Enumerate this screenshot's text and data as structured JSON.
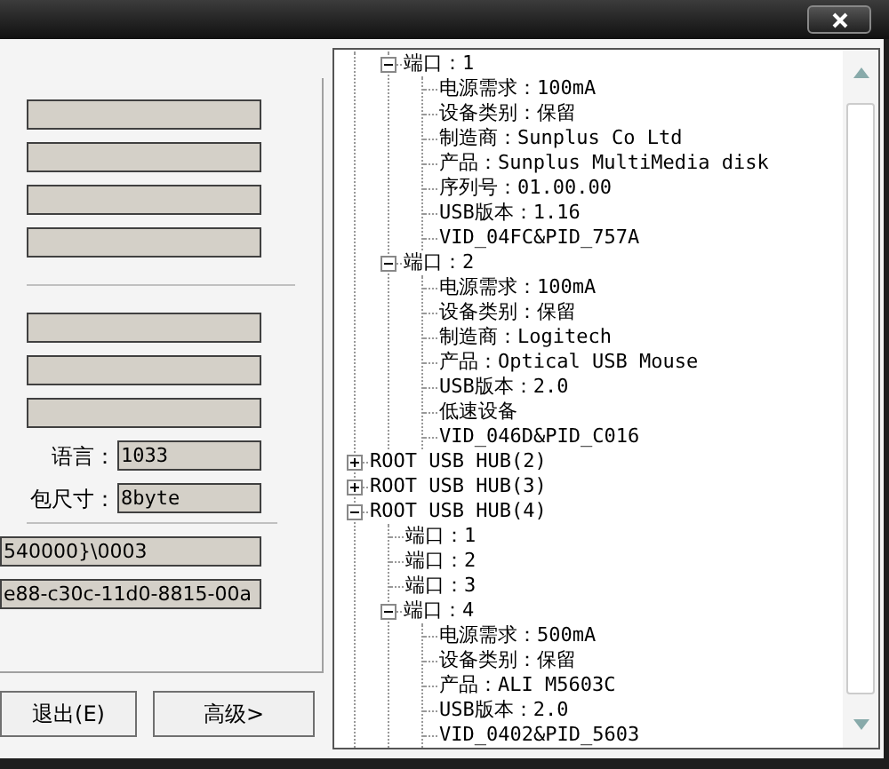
{
  "settings": [
    {
      "label": "语言：",
      "value": "1033"
    },
    {
      "label": "包尺寸：",
      "value": "8byte"
    }
  ],
  "ids": [
    "540000}\\0003",
    "e88-c30c-11d0-8815-00a"
  ],
  "buttons": [
    "退出(E)",
    "高级>"
  ],
  "tree": [
    {
      "children": [
        {
          "label": "端口：1",
          "expanded": true,
          "children": [
            {
              "label": "电源需求：100mA"
            },
            {
              "label": "设备类别：保留"
            },
            {
              "label": "制造商：Sunplus Co Ltd"
            },
            {
              "label": "产品：Sunplus MultiMedia disk"
            },
            {
              "label": "序列号：01.00.00"
            },
            {
              "label": "USB版本：1.16"
            },
            {
              "label": "VID_04FC&PID_757A"
            }
          ]
        },
        {
          "label": "端口：2",
          "expanded": true,
          "children": [
            {
              "label": "电源需求：100mA"
            },
            {
              "label": "设备类别：保留"
            },
            {
              "label": "制造商：Logitech"
            },
            {
              "label": "产品：Optical USB Mouse"
            },
            {
              "label": "USB版本：2.0"
            },
            {
              "label": "低速设备"
            },
            {
              "label": "VID_046D&PID_C016"
            }
          ]
        }
      ]
    },
    {
      "label": "ROOT USB HUB(2)",
      "expanded": false
    },
    {
      "label": "ROOT USB HUB(3)",
      "expanded": false
    },
    {
      "label": "ROOT USB HUB(4)",
      "expanded": true,
      "children": [
        {
          "label": "端口：1"
        },
        {
          "label": "端口：2"
        },
        {
          "label": "端口：3"
        },
        {
          "label": "端口：4",
          "expanded": true,
          "children": [
            {
              "label": "电源需求：500mA"
            },
            {
              "label": "设备类别：保留"
            },
            {
              "label": "产品：ALI M5603C"
            },
            {
              "label": "USB版本：2.0"
            },
            {
              "label": "VID_0402&PID_5603"
            }
          ]
        }
      ]
    }
  ]
}
